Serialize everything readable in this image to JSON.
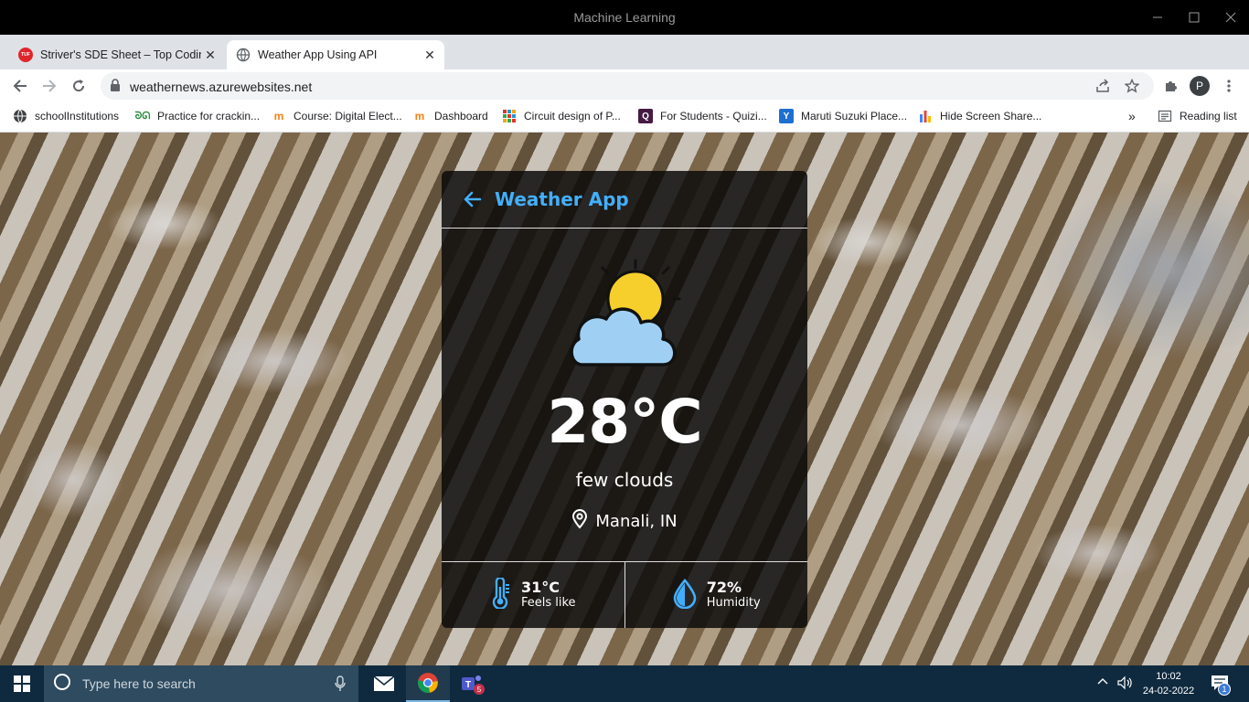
{
  "window": {
    "title": "Machine Learning"
  },
  "tabs": [
    {
      "label": "Striver's SDE Sheet – Top Coding",
      "favicon_text": "TUF",
      "active": false
    },
    {
      "label": "Weather App Using API",
      "active": true
    }
  ],
  "address": {
    "url": "weathernews.azurewebsites.net",
    "profile_initial": "P"
  },
  "bookmarks": [
    {
      "label": "schoolInstitutions",
      "icon": "globe-icon"
    },
    {
      "label": "Practice for crackin...",
      "icon": "gfg-icon"
    },
    {
      "label": "Course: Digital Elect...",
      "icon": "moodle-icon"
    },
    {
      "label": "Dashboard",
      "icon": "moodle-icon"
    },
    {
      "label": "Circuit design  of P...",
      "icon": "tinkercad-icon"
    },
    {
      "label": "For Students - Quizi...",
      "icon": "quizizz-icon"
    },
    {
      "label": "Maruti Suzuki Place...",
      "icon": "yahoo-icon"
    },
    {
      "label": "Hide Screen Share...",
      "icon": "bar-chart-icon"
    }
  ],
  "reading_list": "Reading list",
  "weather": {
    "app_title": "Weather App",
    "temperature": "28°C",
    "description": "few clouds",
    "location": "Manali, IN",
    "feels_like_value": "31°C",
    "feels_like_label": "Feels like",
    "humidity_value": "72%",
    "humidity_label": "Humidity",
    "accent_color": "#43affc"
  },
  "taskbar": {
    "search_placeholder": "Type here to search",
    "time": "10:02",
    "date": "24-02-2022",
    "teams_badge": "5",
    "notification_badge": "1"
  }
}
